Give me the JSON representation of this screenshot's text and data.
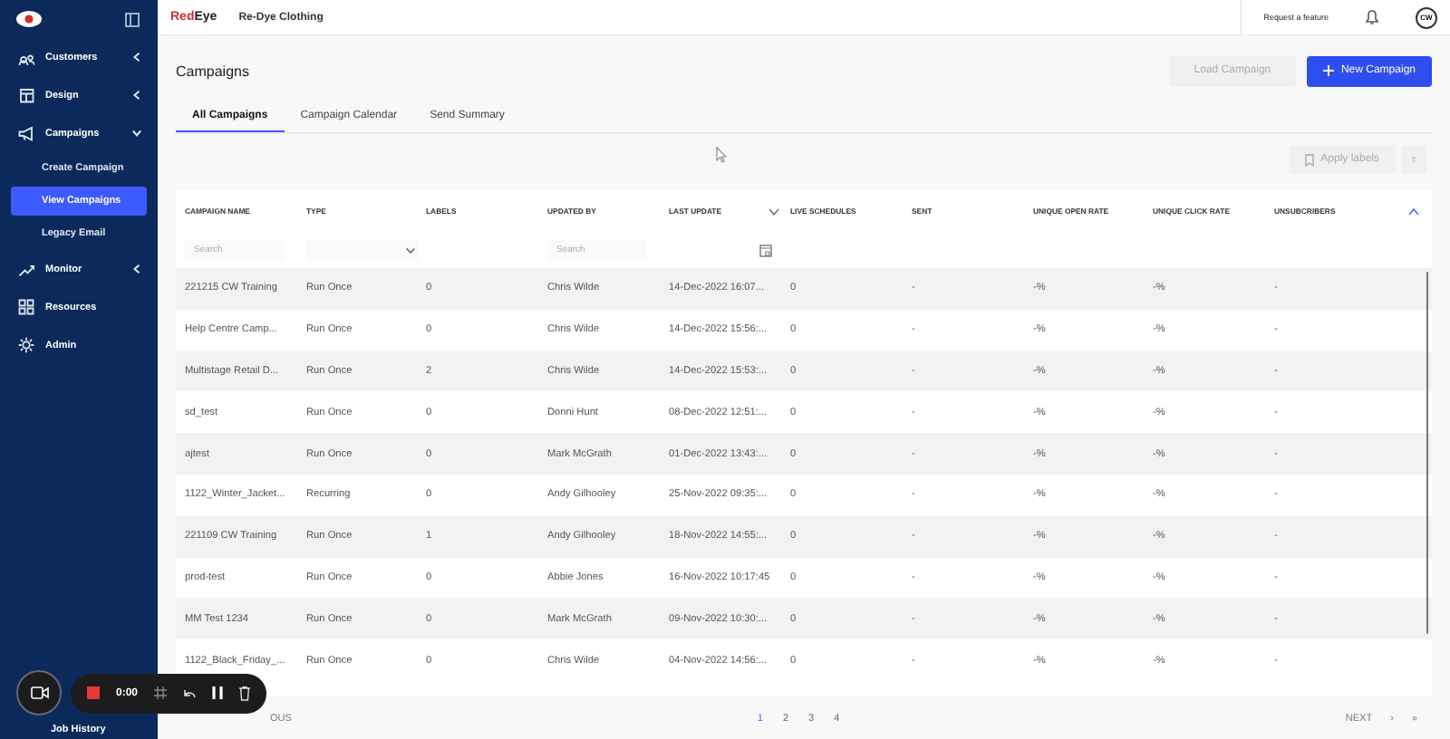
{
  "sidebar": {
    "items": [
      {
        "label": "Customers",
        "kind": "group",
        "expanded": false
      },
      {
        "label": "Design",
        "kind": "group",
        "expanded": false
      },
      {
        "label": "Campaigns",
        "kind": "group",
        "expanded": true,
        "children": [
          {
            "label": "Create Campaign",
            "selected": false
          },
          {
            "label": "View Campaigns",
            "selected": true
          },
          {
            "label": "Legacy Email",
            "selected": false
          }
        ]
      },
      {
        "label": "Monitor",
        "kind": "group",
        "expanded": false
      },
      {
        "label": "Resources",
        "kind": "link"
      },
      {
        "label": "Admin",
        "kind": "link"
      }
    ],
    "footer_item": {
      "label": "Job History"
    }
  },
  "topbar": {
    "logo": [
      "Red",
      "Eye"
    ],
    "account": "Re-Dye Clothing",
    "request_link": "Request a feature",
    "avatar": "CW"
  },
  "page": {
    "title": "Campaigns",
    "buttons": [
      {
        "label": "Load Campaign",
        "kind": "secondary",
        "disabled": true
      },
      {
        "label": "New Campaign",
        "kind": "primary",
        "disabled": false
      }
    ]
  },
  "tabs": [
    {
      "label": "All Campaigns",
      "selected": true
    },
    {
      "label": "Campaign Calendar",
      "selected": false
    },
    {
      "label": "Send Summary",
      "selected": false
    }
  ],
  "toolbar": {
    "apply_labels": {
      "label": "Apply labels",
      "disabled": true
    }
  },
  "table": {
    "columns": [
      "CAMPAIGN NAME",
      "TYPE",
      "LABELS",
      "UPDATED BY",
      "LAST UPDATE",
      "LIVE SCHEDULES",
      "SENT",
      "UNIQUE OPEN RATE",
      "UNIQUE CLICK RATE",
      "UNSUBCRIBERS"
    ],
    "filters": [
      {
        "kind": "search",
        "placeholder": "Search"
      },
      {
        "kind": "select"
      },
      {
        "kind": "none"
      },
      {
        "kind": "search",
        "placeholder": "Search"
      },
      {
        "kind": "date"
      }
    ],
    "rows": [
      [
        "221215 CW Training",
        "Run Once",
        "0",
        "Chris Wilde",
        "14-Dec-2022 16:07...",
        "0",
        "-",
        "-%",
        "-%",
        "-"
      ],
      [
        "Help Centre Camp...",
        "Run Once",
        "0",
        "Chris Wilde",
        "14-Dec-2022 15:56:...",
        "0",
        "-",
        "-%",
        "-%",
        "-"
      ],
      [
        "Multistage Retail D...",
        "Run Once",
        "2",
        "Chris Wilde",
        "14-Dec-2022 15:53:...",
        "0",
        "-",
        "-%",
        "-%",
        "-"
      ],
      [
        "sd_test",
        "Run Once",
        "0",
        "Donni Hunt",
        "08-Dec-2022 12:51:...",
        "0",
        "-",
        "-%",
        "-%",
        "-"
      ],
      [
        "ajtest",
        "Run Once",
        "0",
        "Mark McGrath",
        "01-Dec-2022 13:43:...",
        "0",
        "-",
        "-%",
        "-%",
        "-"
      ],
      [
        "1122_Winter_Jacket...",
        "Recurring",
        "0",
        "Andy Gilhooley",
        "25-Nov-2022 09:35:...",
        "0",
        "-",
        "-%",
        "-%",
        "-"
      ],
      [
        "221109 CW Training",
        "Run Once",
        "1",
        "Andy Gilhooley",
        "18-Nov-2022 14:55:...",
        "0",
        "-",
        "-%",
        "-%",
        "-"
      ],
      [
        "prod-test",
        "Run Once",
        "0",
        "Abbie Jones",
        "16-Nov-2022 10:17:45",
        "0",
        "-",
        "-%",
        "-%",
        "-"
      ],
      [
        "MM Test 1234",
        "Run Once",
        "0",
        "Mark McGrath",
        "09-Nov-2022 10:30:...",
        "0",
        "-",
        "-%",
        "-%",
        "-"
      ],
      [
        "1122_Black_Friday_...",
        "Run Once",
        "0",
        "Chris Wilde",
        "04-Nov-2022 14:56:...",
        "0",
        "-",
        "-%",
        "-%",
        "-"
      ]
    ]
  },
  "pagination": {
    "previous": "OUS",
    "pages": [
      {
        "label": "1",
        "selected": true
      },
      {
        "label": "2",
        "selected": false
      },
      {
        "label": "3",
        "selected": false
      },
      {
        "label": "4",
        "selected": false
      }
    ],
    "next": "NEXT",
    "next_icon": "›",
    "last_icon": "»"
  },
  "recorder": {
    "time": "0:00"
  }
}
